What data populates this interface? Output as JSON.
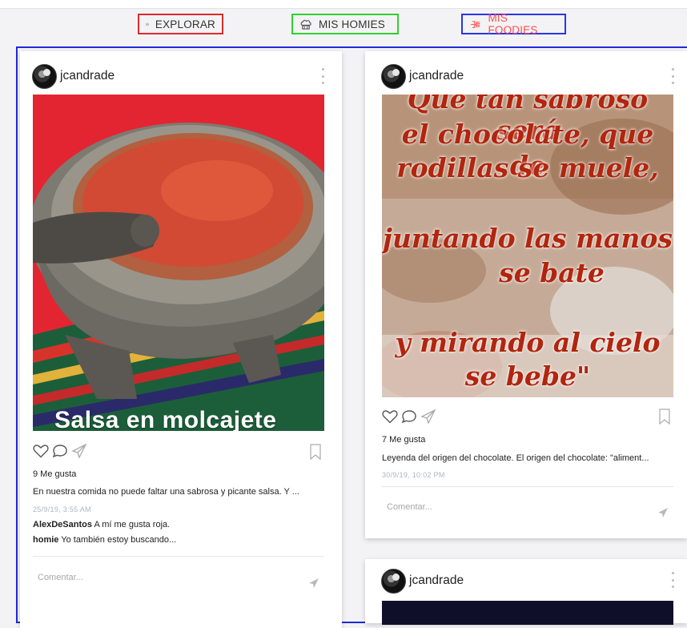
{
  "tabs": {
    "explorar": "EXPLORAR",
    "homies": "MIS HOMIES",
    "foodies": "MIS FOODIES"
  },
  "colors": {
    "accent_red": "#e02a2a",
    "accent_green": "#2fd12f",
    "accent_blue": "#2a35e6",
    "foodies_text": "#ff4d4d"
  },
  "icons": {
    "explorar": "compass-icon",
    "homies": "chef-hat-icon",
    "foodies": "fork-icon",
    "like": "heart-icon",
    "comment": "speech-bubble-icon",
    "share": "paper-plane-icon",
    "save": "bookmark-icon",
    "send": "send-icon",
    "menu": "more-vertical-icon"
  },
  "posts": [
    {
      "username": "jcandrade",
      "image_caption": "Salsa en molcajete",
      "likes": "9 Me gusta",
      "description": "En nuestra comida no puede faltar una sabrosa y picante salsa. Y ...",
      "date": "25/9/19, 3:55 AM",
      "comments": [
        {
          "user": "AlexDeSantos",
          "text": "A mí me gusta roja."
        },
        {
          "user": "homie",
          "text": "Yo también estoy buscando..."
        }
      ],
      "comment_placeholder": "Comentar..."
    },
    {
      "username": "jcandrade",
      "image_text": [
        "Que tan sabroso será",
        "el chocolate, que de",
        "rodillas se muele,",
        "juntando las manos",
        "se bate",
        "y mirando al cielo",
        "se bebe\""
      ],
      "likes": "7 Me gusta",
      "description": "Leyenda del origen del chocolate. El origen del chocolate: \"aliment...",
      "date": "30/9/19, 10:02 PM",
      "comment_placeholder": "Comentar..."
    },
    {
      "username": "jcandrade"
    }
  ]
}
